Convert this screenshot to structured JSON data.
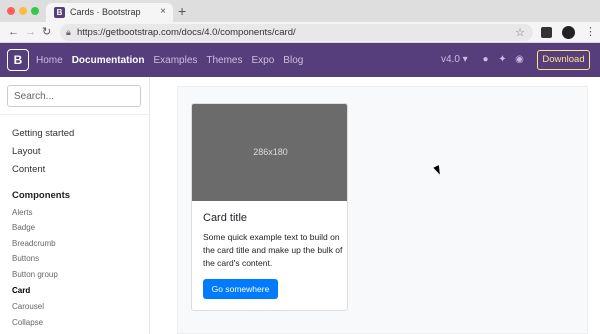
{
  "browser": {
    "tab_title": "Cards · Bootstrap",
    "tab_favicon": "B",
    "tab_close": "×",
    "new_tab": "+",
    "url": "https://getbootstrap.com/docs/4.0/components/card/",
    "icons": [
      "back-arrow-icon",
      "forward-arrow-icon",
      "reload-icon",
      "lock-icon",
      "star-icon",
      "extension-icon",
      "profile-avatar-icon",
      "menu-kebab-icon"
    ]
  },
  "navbar": {
    "brand": "B",
    "links": [
      "Home",
      "Documentation",
      "Examples",
      "Themes",
      "Expo",
      "Blog"
    ],
    "active_link": "Documentation",
    "version": "v4.0 ▾",
    "download": "Download",
    "social_icons": [
      "github-icon",
      "twitter-icon",
      "slack-icon"
    ],
    "colors": {
      "background": "#563d7c",
      "download_border": "#ffe484"
    }
  },
  "sidebar": {
    "search_placeholder": "Search...",
    "top_items": [
      "Getting started",
      "Layout",
      "Content"
    ],
    "section_heading": "Components",
    "component_items": [
      "Alerts",
      "Badge",
      "Breadcrumb",
      "Buttons",
      "Button group",
      "Card",
      "Carousel",
      "Collapse"
    ],
    "current_item": "Card"
  },
  "main": {
    "card": {
      "image_label": "286x180",
      "title": "Card title",
      "text": "Some quick example text to build on the card title and make up the bulk of the card's content.",
      "button": "Go somewhere",
      "colors": {
        "button": "#007bff",
        "image": "#6b6b6b"
      }
    }
  }
}
